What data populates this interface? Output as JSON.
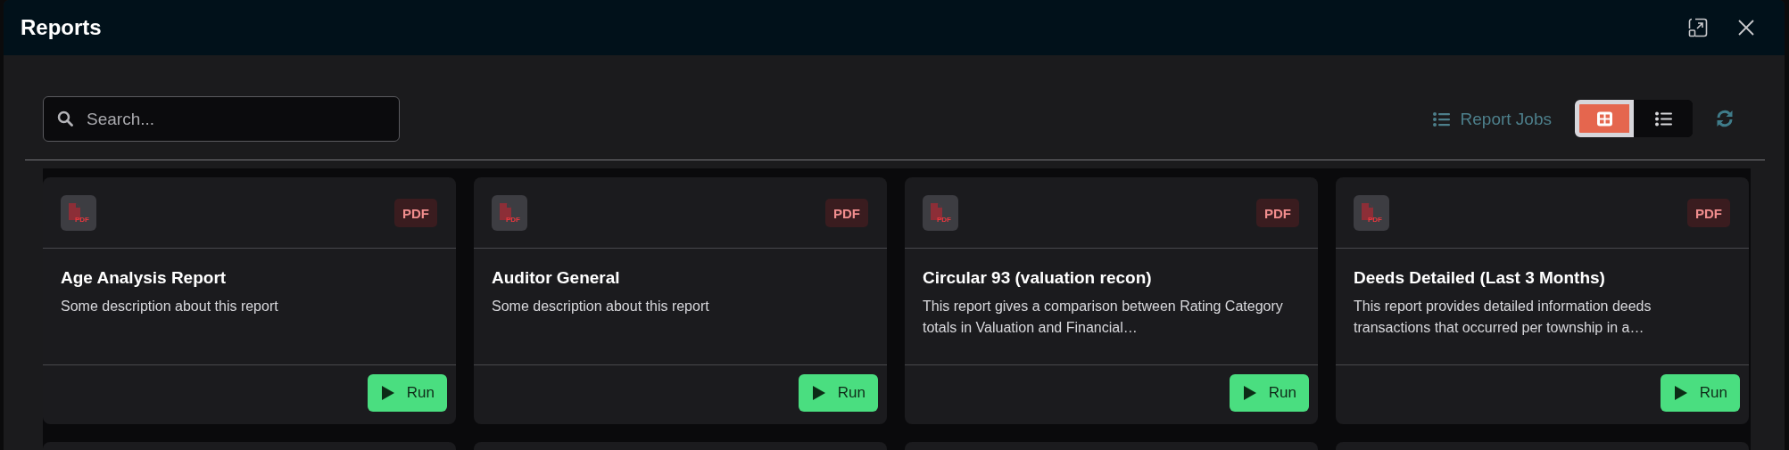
{
  "window": {
    "title": "Reports"
  },
  "search": {
    "placeholder": "Search..."
  },
  "toolbar": {
    "report_jobs": "Report Jobs",
    "view_toggle": [
      {
        "kind": "grid",
        "selected": true
      },
      {
        "kind": "list",
        "selected": false
      }
    ]
  },
  "cards": [
    {
      "icon_label": "PDF",
      "badge": "PDF",
      "title": "Age Analysis Report",
      "description": "Some description about this report",
      "run": "Run"
    },
    {
      "icon_label": "PDF",
      "badge": "PDF",
      "title": "Auditor General",
      "description": "Some description about this report",
      "run": "Run"
    },
    {
      "icon_label": "PDF",
      "badge": "PDF",
      "title": "Circular 93 (valuation recon)",
      "description": "This report gives a comparison between Rating Category totals in Valuation and Financial…",
      "run": "Run"
    },
    {
      "icon_label": "PDF",
      "badge": "PDF",
      "title": "Deeds Detailed (Last 3 Months)",
      "description": "This report provides detailed information deeds transactions that occurred per township in a…",
      "run": "Run"
    }
  ]
}
